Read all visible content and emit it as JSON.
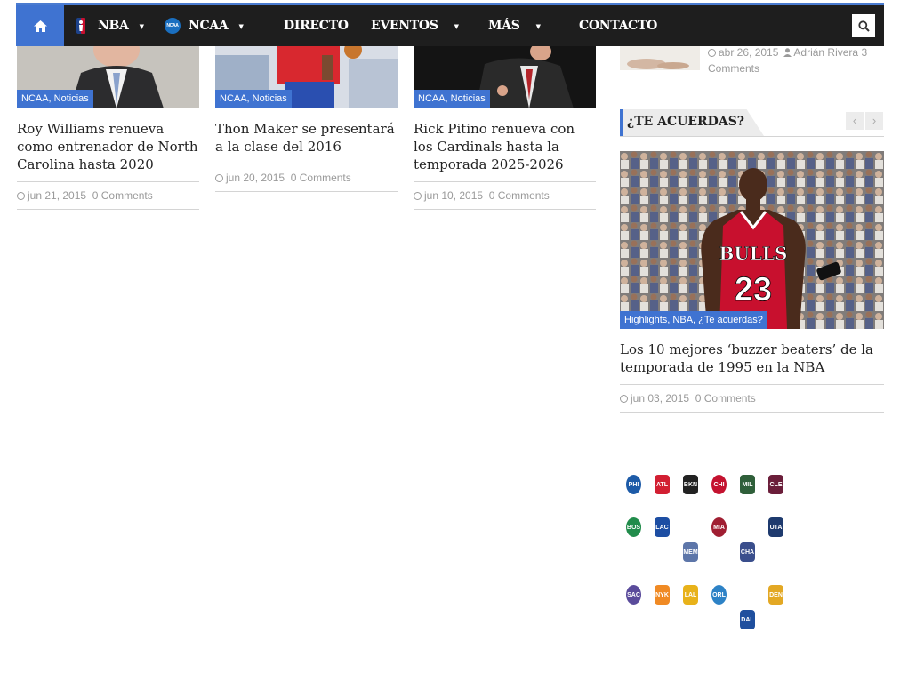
{
  "nav": {
    "items": [
      {
        "label": "NBA",
        "has_dropdown": true,
        "icon": "nba-logo-icon"
      },
      {
        "label": "NCAA",
        "has_dropdown": true,
        "icon": "ncaa-logo-icon"
      },
      {
        "label": "DIRECTO",
        "has_dropdown": false
      },
      {
        "label": "EVENTOS",
        "has_dropdown": true
      },
      {
        "label": "MÁS",
        "has_dropdown": true
      },
      {
        "label": "CONTACTO",
        "has_dropdown": false
      }
    ],
    "ncaa_badge": "NCAA",
    "accent_color": "#3f73d1",
    "bar_color": "#1e1e1e"
  },
  "posts": [
    {
      "category": "NCAA, Noticias",
      "title": "Roy Williams renueva como entrenador de North Carolina hasta 2020",
      "date": "jun 21, 2015",
      "comments": "0 Comments"
    },
    {
      "category": "NCAA, Noticias",
      "title": "Thon Maker se presentará a la clase del 2016",
      "date": "jun 20, 2015",
      "comments": "0 Comments"
    },
    {
      "category": "NCAA, Noticias",
      "title": "Rick Pitino renueva con los Cardinals hasta la temporada 2025-2026",
      "date": "jun 10, 2015",
      "comments": "0 Comments"
    }
  ],
  "sidebar": {
    "recent_post": {
      "date": "abr 26, 2015",
      "author": "Adrián Rivera",
      "comments": "3 Comments"
    },
    "widget_title": "¿TE ACUERDAS?",
    "prev_label": "‹",
    "next_label": "›",
    "featured": {
      "category": "Highlights, NBA, ¿Te acuerdas?",
      "title": "Los 10 mejores ‘buzzer beaters’ de la temporada de 1995 en la NBA",
      "date": "jun 03, 2015",
      "comments": "0 Comments",
      "jersey_team": "BULLS",
      "jersey_number": "23"
    },
    "team_logos": [
      {
        "name": "76ers",
        "color": "#1d5ba8",
        "abbr": "PHI"
      },
      {
        "name": "Hawks",
        "color": "#d21f32",
        "abbr": "ATL"
      },
      {
        "name": "Nets",
        "color": "#222222",
        "abbr": "BKN"
      },
      {
        "name": "Bulls",
        "color": "#c4122f",
        "abbr": "CHI"
      },
      {
        "name": "Bucks",
        "color": "#2f5f3a",
        "abbr": "MIL"
      },
      {
        "name": "Cavaliers",
        "color": "#6b1e3a",
        "abbr": "CLE"
      },
      {
        "name": "Celtics",
        "color": "#218c4b",
        "abbr": "BOS"
      },
      {
        "name": "Clippers",
        "color": "#1d4ea3",
        "abbr": "LAC"
      },
      {
        "name": "Grizzlies",
        "color": "#5d76a9",
        "abbr": "MEM"
      },
      {
        "name": "Heat",
        "color": "#a01e32",
        "abbr": "MIA"
      },
      {
        "name": "Hornets",
        "color": "#3a4e8c",
        "abbr": "CHA"
      },
      {
        "name": "Jazz",
        "color": "#1e3a6e",
        "abbr": "UTA"
      },
      {
        "name": "Kings",
        "color": "#5a4b9b",
        "abbr": "SAC"
      },
      {
        "name": "Knicks",
        "color": "#f08a24",
        "abbr": "NYK"
      },
      {
        "name": "Lakers",
        "color": "#e8b21a",
        "abbr": "LAL"
      },
      {
        "name": "Magic",
        "color": "#2d82c6",
        "abbr": "ORL"
      },
      {
        "name": "Mavericks",
        "color": "#1f4f9e",
        "abbr": "DAL"
      },
      {
        "name": "Nuggets",
        "color": "#e3a824",
        "abbr": "DEN"
      }
    ]
  }
}
